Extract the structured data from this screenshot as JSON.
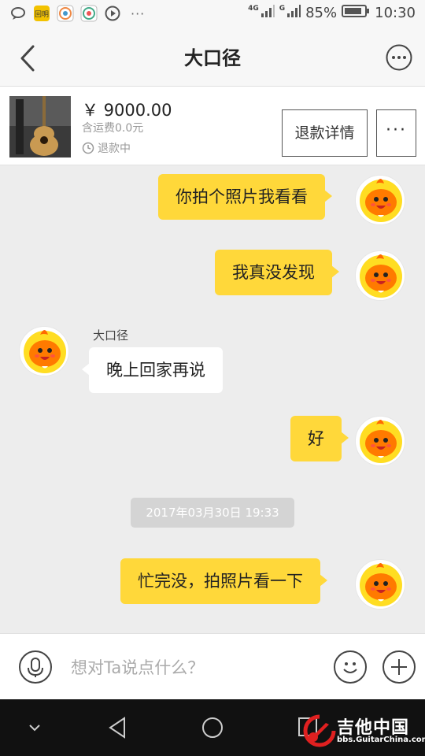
{
  "statusbar": {
    "network": "4G",
    "network2": "G",
    "battery": "85%",
    "time": "10:30",
    "dots": "···",
    "app_icon_text": "回明"
  },
  "header": {
    "title": "大口径",
    "back_icon": "chevron-left-icon",
    "more_icon": "more-circle-icon"
  },
  "product": {
    "price": "￥ 9000.00",
    "shipping": "含运费0.0元",
    "status": "退款中",
    "refund_button": "退款详情",
    "more_button": "···"
  },
  "messages": [
    {
      "side": "me",
      "text": "你拍个照片我看看"
    },
    {
      "side": "me",
      "text": "我真没发现"
    },
    {
      "side": "other",
      "sender": "大口径",
      "text": "晚上回家再说"
    },
    {
      "side": "me",
      "text": "好"
    },
    {
      "side": "me",
      "text": "忙完没，拍照片看一下"
    }
  ],
  "timestamp": "2017年03月30日 19:33",
  "input": {
    "placeholder": "想对Ta说点什么？",
    "icons": [
      "microphone-icon",
      "emoji-icon",
      "plus-icon"
    ]
  },
  "watermark": {
    "title": "吉他中国",
    "subtitle": "bbs.GuitarChina.com"
  },
  "colors": {
    "my_bubble": "#ffd83a",
    "other_bubble": "#ffffff",
    "background": "#ededed"
  }
}
